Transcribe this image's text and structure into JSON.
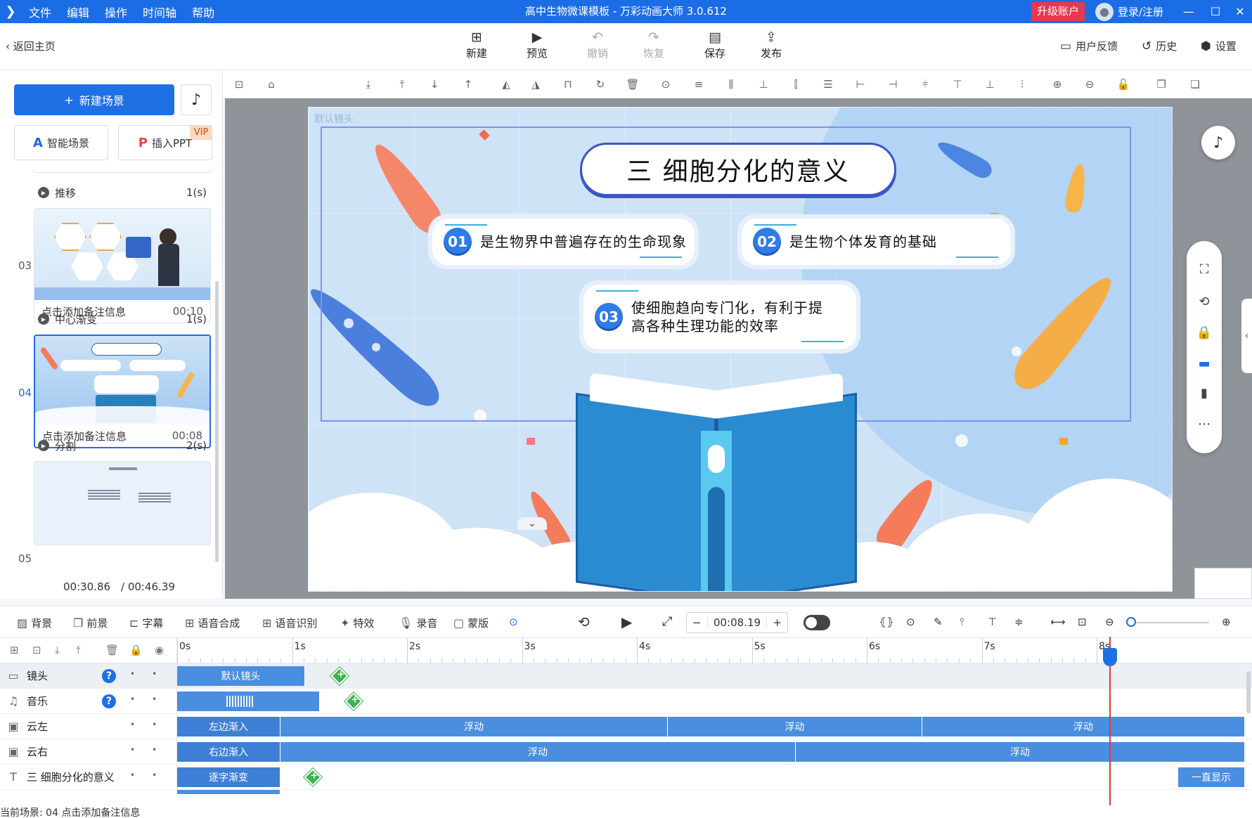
{
  "window": {
    "title": "高中生物微课模板 - 万彩动画大师 3.0.612",
    "menu": [
      "文件",
      "编辑",
      "操作",
      "时间轴",
      "帮助"
    ],
    "upgrade_label": "升级账户",
    "login_label": "登录/注册"
  },
  "toolbar": {
    "back_label": "返回主页",
    "buttons": [
      {
        "label": "新建",
        "icon": "plus-square-icon"
      },
      {
        "label": "预览",
        "icon": "play-icon"
      },
      {
        "label": "撤销",
        "icon": "undo-icon"
      },
      {
        "label": "恢复",
        "icon": "redo-icon"
      },
      {
        "label": "保存",
        "icon": "save-icon"
      },
      {
        "label": "发布",
        "icon": "publish-icon"
      }
    ],
    "right_links": [
      {
        "label": "用户反馈",
        "icon": "feedback-icon"
      },
      {
        "label": "历史",
        "icon": "history-icon"
      },
      {
        "label": "设置",
        "icon": "gear-icon"
      }
    ]
  },
  "left_panel": {
    "new_scene_label": "新建场景",
    "smart_scene_label": "智能场景",
    "insert_ppt_label": "插入PPT",
    "vip_label": "VIP",
    "transitions": [
      {
        "name": "推移",
        "duration": "1(s)"
      },
      {
        "name": "中心渐变",
        "duration": "1(s)"
      },
      {
        "name": "分割",
        "duration": "2(s)"
      }
    ],
    "scenes": [
      {
        "number": "03",
        "note": "点击添加备注信息",
        "time": "00:10"
      },
      {
        "number": "04",
        "note": "点击添加备注信息",
        "time": "00:08"
      },
      {
        "number": "05",
        "note": "",
        "time": ""
      }
    ],
    "current_time": "00:30.86",
    "total_time": "/ 00:46.39"
  },
  "canvas": {
    "camera_label": "默认镜头",
    "title": "三  细胞分化的意义",
    "points": [
      {
        "badge": "01",
        "text": "是生物界中普遍存在的生命现象"
      },
      {
        "badge": "02",
        "text": "是生物个体发育的基础"
      },
      {
        "badge": "03",
        "text_line1": "使细胞趋向专门化，有利于提",
        "text_line2": "高各种生理功能的效率"
      }
    ]
  },
  "controls": {
    "left": [
      {
        "label": "背景",
        "icon": "background-icon"
      },
      {
        "label": "前景",
        "icon": "foreground-icon"
      },
      {
        "label": "字幕",
        "icon": "caption-icon"
      },
      {
        "label": "语音合成",
        "icon": "tts-icon"
      },
      {
        "label": "语音识别",
        "icon": "asr-icon"
      },
      {
        "label": "特效",
        "icon": "effects-icon"
      },
      {
        "label": "录音",
        "icon": "mic-icon"
      },
      {
        "label": "蒙版",
        "icon": "mask-icon"
      }
    ],
    "time_value": "00:08.19",
    "minus": "−",
    "plus": "+"
  },
  "timeline": {
    "ruler": [
      "0s",
      "1s",
      "2s",
      "3s",
      "4s",
      "5s",
      "6s",
      "7s",
      "8s"
    ],
    "tracks": [
      {
        "name": "镜头",
        "icon": "camera-icon"
      },
      {
        "name": "音乐",
        "icon": "music-icon"
      },
      {
        "name": "云左",
        "icon": "image-icon"
      },
      {
        "name": "云右",
        "icon": "image-icon"
      },
      {
        "name": "三  细胞分化的意义",
        "icon": "text-icon"
      }
    ],
    "segments": {
      "camera": "默认镜头",
      "cloud_left": [
        "左边渐入",
        "浮动",
        "浮动",
        "浮动"
      ],
      "cloud_right": [
        "右边渐入",
        "浮动",
        "浮动"
      ],
      "title": [
        "逐字渐变",
        "一直显示"
      ]
    },
    "status": "当前场景: 04   点击添加备注信息"
  }
}
